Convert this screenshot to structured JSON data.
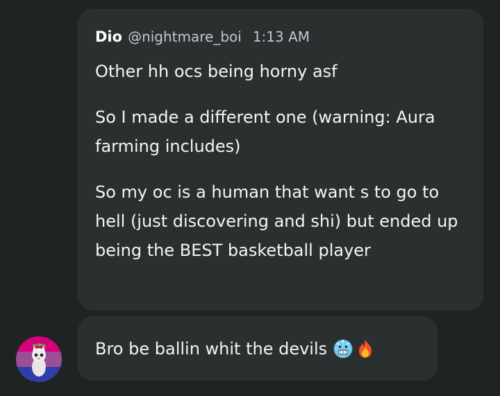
{
  "message": {
    "author": "Dio",
    "handle": "@nightmare_boi",
    "time": "1:13 AM",
    "paragraphs": [
      "Other hh ocs being horny asf",
      "So I made a different one (warning: Aura farming includes)",
      "So my oc is a human that want s to go to hell (just discovering and shi) but ended up being the BEST basketball player"
    ]
  },
  "reply": {
    "text": "Bro be ballin whit the devils",
    "emojis": [
      "cold-face-emoji",
      "fire-emoji"
    ]
  },
  "avatar": {
    "stripe_colors": [
      "#d6007a",
      "#9b4f96",
      "#2f3fa8"
    ]
  }
}
